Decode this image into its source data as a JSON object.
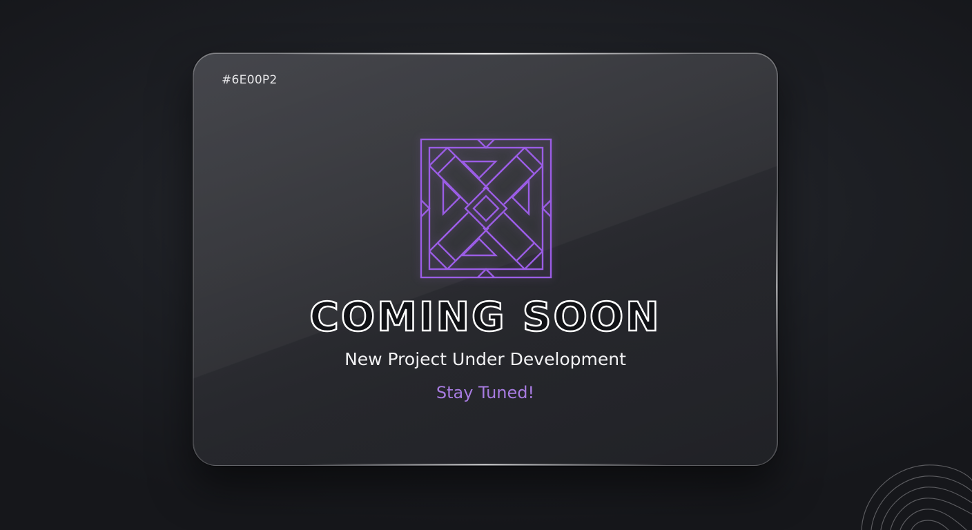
{
  "card": {
    "code": "#6E00P2",
    "headline": "COMING SOON",
    "subtitle": "New Project Under Development",
    "tagline": "Stay Tuned!"
  },
  "logo": {
    "icon": "interlaced-square-knot-icon",
    "color": "#9b5de5"
  },
  "decoration": {
    "icon": "swirl-lines-icon"
  },
  "colors": {
    "background": "#1d1f24",
    "card": "#303136",
    "accent": "#a77be0",
    "text": "#f2f2f4"
  }
}
